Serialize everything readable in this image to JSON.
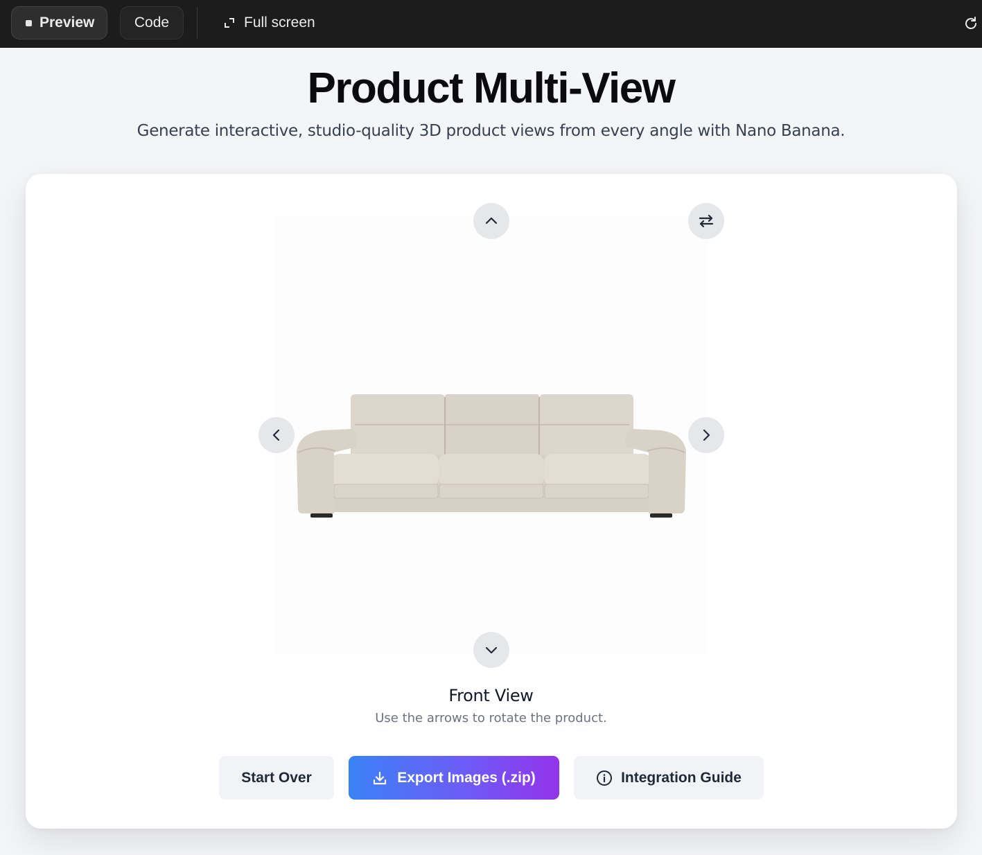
{
  "toolbar": {
    "preview_label": "Preview",
    "code_label": "Code",
    "fullscreen_label": "Full screen"
  },
  "header": {
    "title": "Product Multi-View",
    "subtitle": "Generate interactive, studio-quality 3D product views from every angle with Nano Banana."
  },
  "viewer": {
    "current_view": "Front View",
    "hint": "Use the arrows to rotate the product.",
    "product": "sofa"
  },
  "actions": {
    "start_over": "Start Over",
    "export": "Export Images (.zip)",
    "guide": "Integration Guide"
  },
  "icons": {
    "up": "chevron-up-icon",
    "down": "chevron-down-icon",
    "left": "chevron-left-icon",
    "right": "chevron-right-icon",
    "swap": "swap-arrows-icon",
    "download": "download-icon",
    "info": "info-icon",
    "fullscreen": "expand-icon",
    "reload": "reload-icon"
  },
  "colors": {
    "toolbar_bg": "#1c1c1c",
    "page_bg": "#f4f5f7",
    "gradient_start": "#3b82f6",
    "gradient_end": "#9333ea"
  }
}
